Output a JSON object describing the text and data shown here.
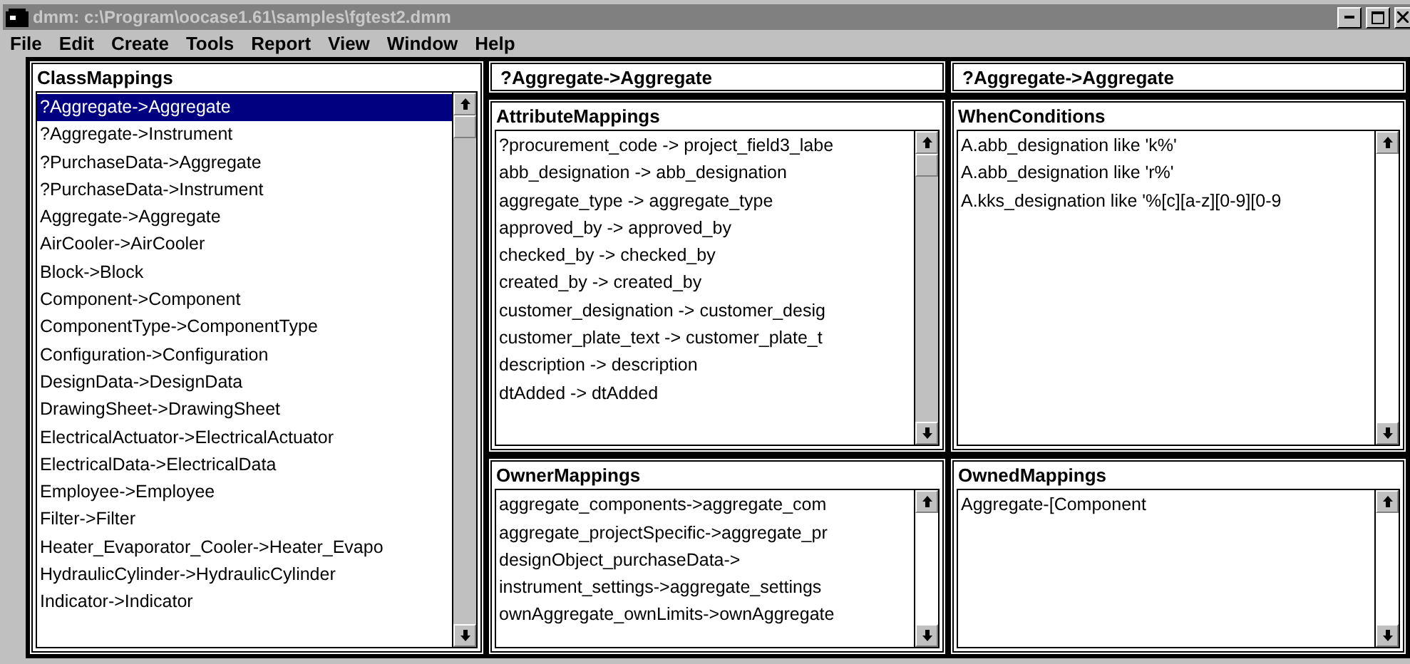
{
  "window": {
    "title": "dmm: c:\\Program\\oocase1.61\\samples\\fgtest2.dmm"
  },
  "menu": [
    "File",
    "Edit",
    "Create",
    "Tools",
    "Report",
    "View",
    "Window",
    "Help"
  ],
  "class_mappings": {
    "title": "ClassMappings",
    "scroll_thumb": true,
    "items": [
      {
        "label": "?Aggregate->Aggregate",
        "selected": true
      },
      {
        "label": "?Aggregate->Instrument",
        "selected": false
      },
      {
        "label": "?PurchaseData->Aggregate",
        "selected": false
      },
      {
        "label": "?PurchaseData->Instrument",
        "selected": false
      },
      {
        "label": "Aggregate->Aggregate",
        "selected": false
      },
      {
        "label": "AirCooler->AirCooler",
        "selected": false
      },
      {
        "label": "Block->Block",
        "selected": false
      },
      {
        "label": "Component->Component",
        "selected": false
      },
      {
        "label": "ComponentType->ComponentType",
        "selected": false
      },
      {
        "label": "Configuration->Configuration",
        "selected": false
      },
      {
        "label": "DesignData->DesignData",
        "selected": false
      },
      {
        "label": "DrawingSheet->DrawingSheet",
        "selected": false
      },
      {
        "label": "ElectricalActuator->ElectricalActuator",
        "selected": false
      },
      {
        "label": "ElectricalData->ElectricalData",
        "selected": false
      },
      {
        "label": "Employee->Employee",
        "selected": false
      },
      {
        "label": "Filter->Filter",
        "selected": false
      },
      {
        "label": "Heater_Evaporator_Cooler->Heater_Evapo",
        "selected": false
      },
      {
        "label": "HydraulicCylinder->HydraulicCylinder",
        "selected": false
      },
      {
        "label": "Indicator->Indicator",
        "selected": false
      }
    ]
  },
  "columns": [
    {
      "header": "?Aggregate->Aggregate",
      "panels": [
        {
          "title": "AttributeMappings",
          "scroll_thumb": true,
          "items": [
            "?procurement_code -> project_field3_labe",
            "abb_designation -> abb_designation",
            "aggregate_type -> aggregate_type",
            "approved_by -> approved_by",
            "checked_by -> checked_by",
            "created_by -> created_by",
            "customer_designation -> customer_desig",
            "customer_plate_text -> customer_plate_t",
            "description -> description",
            "dtAdded -> dtAdded"
          ]
        },
        {
          "title": "OwnerMappings",
          "scroll_thumb": false,
          "items": [
            "aggregate_components->aggregate_com",
            "aggregate_projectSpecific->aggregate_pr",
            "designObject_purchaseData->",
            "instrument_settings->aggregate_settings",
            "ownAggregate_ownLimits->ownAggregate"
          ]
        }
      ]
    },
    {
      "header": "?Aggregate->Aggregate",
      "panels": [
        {
          "title": "WhenConditions",
          "scroll_thumb": false,
          "items": [
            "A.abb_designation like 'k%'",
            "A.abb_designation like 'r%'",
            "A.kks_designation like '%[c][a-z][0-9][0-9"
          ]
        },
        {
          "title": "OwnedMappings",
          "scroll_thumb": false,
          "items": [
            "Aggregate-[Component"
          ]
        }
      ]
    }
  ]
}
